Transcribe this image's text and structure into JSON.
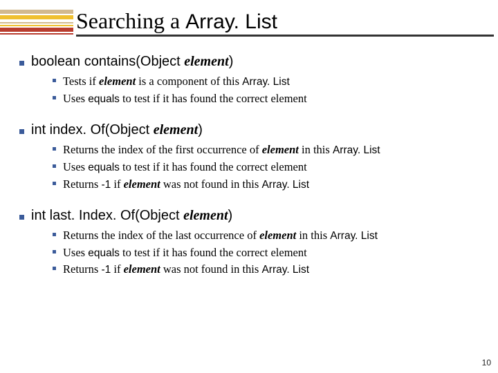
{
  "title": {
    "pre": "Searching a ",
    "code": "Array. List"
  },
  "methods": [
    {
      "sig": {
        "pre": "boolean contains(Object ",
        "param": "element",
        "post": ")"
      },
      "subs": [
        [
          {
            "t": "Tests if "
          },
          {
            "t": "element",
            "cls": "param"
          },
          {
            "t": " is a component of this "
          },
          {
            "t": "Array. List",
            "cls": "vd"
          }
        ],
        [
          {
            "t": "Uses "
          },
          {
            "t": "equals",
            "cls": "vd"
          },
          {
            "t": " to test if it has found the correct element"
          }
        ]
      ]
    },
    {
      "sig": {
        "pre": "int index. Of(Object ",
        "param": "element",
        "post": ")"
      },
      "subs": [
        [
          {
            "t": "Returns the index of the first occurrence of "
          },
          {
            "t": "element",
            "cls": "param"
          },
          {
            "t": " in this "
          },
          {
            "t": "Array. List",
            "cls": "vd"
          }
        ],
        [
          {
            "t": "Uses "
          },
          {
            "t": "equals",
            "cls": "vd"
          },
          {
            "t": " to test if it has found the correct element"
          }
        ],
        [
          {
            "t": "Returns "
          },
          {
            "t": "-1",
            "cls": "vd"
          },
          {
            "t": " if "
          },
          {
            "t": "element",
            "cls": "param"
          },
          {
            "t": " was not found in this "
          },
          {
            "t": "Array. List",
            "cls": "vd"
          }
        ]
      ]
    },
    {
      "sig": {
        "pre": "int last. Index. Of(Object ",
        "param": "element",
        "post": ")"
      },
      "subs": [
        [
          {
            "t": "Returns the index of the last occurrence of "
          },
          {
            "t": "element",
            "cls": "param"
          },
          {
            "t": " in this "
          },
          {
            "t": "Array. List",
            "cls": "vd"
          }
        ],
        [
          {
            "t": "Uses "
          },
          {
            "t": "equals",
            "cls": "vd"
          },
          {
            "t": " to test if it has found the correct element"
          }
        ],
        [
          {
            "t": "Returns "
          },
          {
            "t": "-1",
            "cls": "vd"
          },
          {
            "t": " if "
          },
          {
            "t": "element",
            "cls": "param"
          },
          {
            "t": " was not found in this "
          },
          {
            "t": "Array. List",
            "cls": "vd"
          }
        ]
      ]
    }
  ],
  "pagenum": "10"
}
